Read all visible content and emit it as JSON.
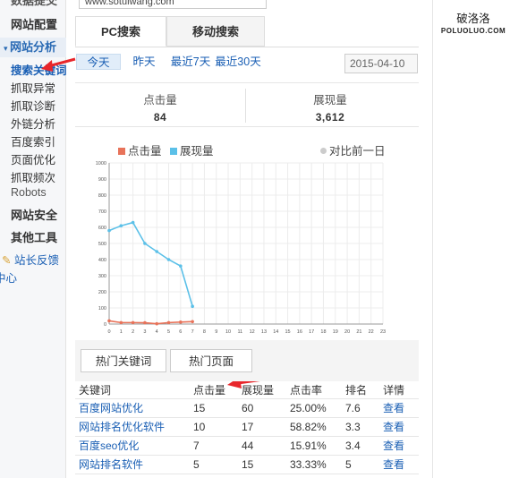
{
  "sidebar": {
    "cutoff_top": "数据提交",
    "section_config": "网站配置",
    "section_analysis": "网站分析",
    "items": [
      {
        "label": "搜索关键词"
      },
      {
        "label": "抓取异常"
      },
      {
        "label": "抓取诊断"
      },
      {
        "label": "外链分析"
      },
      {
        "label": "百度索引"
      },
      {
        "label": "页面优化"
      },
      {
        "label": "抓取频次"
      },
      {
        "label": "Robots"
      }
    ],
    "section_security": "网站安全",
    "section_tools": "其他工具",
    "feedback": "站长反馈",
    "feedback_sub": "中心"
  },
  "url_box": {
    "value": "www.sotuiwang.com"
  },
  "tabs": {
    "pc": "PC搜索",
    "mobile": "移动搜索"
  },
  "time_tabs": [
    "今天",
    "昨天",
    "最近7天",
    "最近30天"
  ],
  "date": "2015-04-10",
  "stats": {
    "clicks_label": "点击量",
    "clicks_value": "84",
    "impressions_label": "展现量",
    "impressions_value": "3,612"
  },
  "chart_data": {
    "type": "line",
    "legend": [
      "点击量",
      "展现量",
      "对比前一日"
    ],
    "x": [
      0,
      1,
      2,
      3,
      4,
      5,
      6,
      7
    ],
    "xticks": [
      0,
      1,
      2,
      3,
      4,
      5,
      6,
      7,
      8,
      9,
      10,
      11,
      12,
      13,
      14,
      15,
      16,
      17,
      18,
      19,
      20,
      21,
      22,
      23
    ],
    "yticks": [
      0,
      100,
      200,
      300,
      400,
      500,
      600,
      700,
      800,
      900,
      1000
    ],
    "ylim": [
      0,
      1000
    ],
    "xlim": [
      0,
      23
    ],
    "grid": true,
    "series": [
      {
        "name": "点击量",
        "color": "#e8735a",
        "values": [
          20,
          9,
          9,
          8,
          2,
          9,
          12,
          15
        ]
      },
      {
        "name": "展现量",
        "color": "#5bc0e8",
        "values": [
          580,
          610,
          630,
          500,
          450,
          400,
          360,
          110
        ]
      }
    ]
  },
  "sub_tabs": [
    "热门关键词",
    "热门页面"
  ],
  "table": {
    "headers": [
      "关键词",
      "点击量",
      "展现量",
      "点击率",
      "排名",
      "详情"
    ],
    "rows": [
      [
        "百度网站优化",
        "15",
        "60",
        "25.00%",
        "7.6",
        "查看"
      ],
      [
        "网站排名优化软件",
        "10",
        "17",
        "58.82%",
        "3.3",
        "查看"
      ],
      [
        "百度seo优化",
        "7",
        "44",
        "15.91%",
        "3.4",
        "查看"
      ],
      [
        "网站排名软件",
        "5",
        "15",
        "33.33%",
        "5",
        "查看"
      ]
    ]
  },
  "logo": {
    "cn": "破洛洛",
    "en": "POLUOLUO.COM"
  },
  "colors": {
    "accent": "#1a5fb4",
    "click_series": "#e8735a",
    "impression_series": "#5bc0e8",
    "arrow": "#e8262b"
  }
}
